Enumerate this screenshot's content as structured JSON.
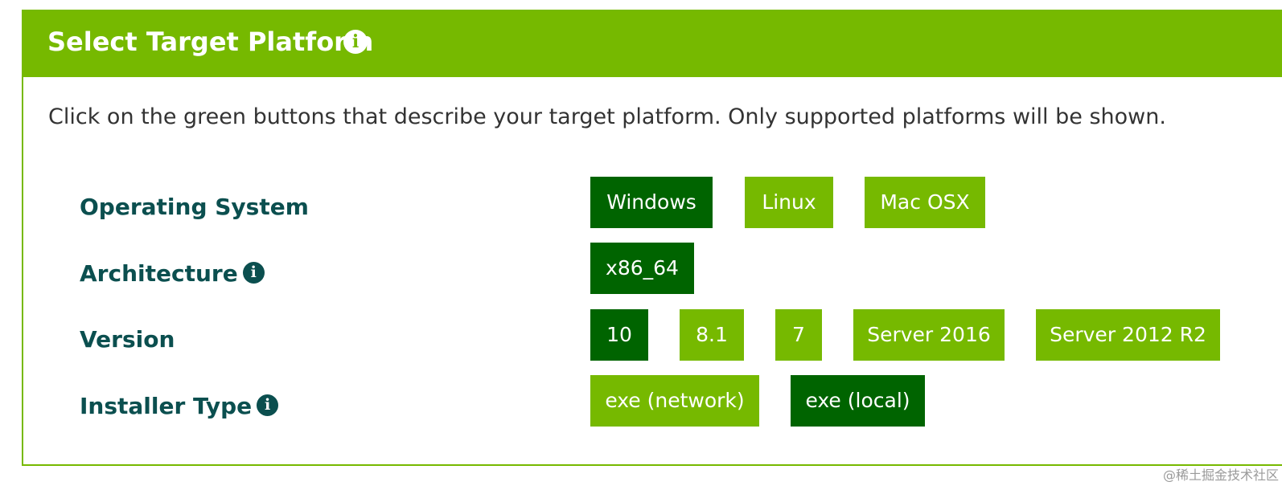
{
  "header": {
    "title": "Select Target Platform",
    "info_icon": "info-circle-icon"
  },
  "description": "Click on the green buttons that describe your target platform. Only supported platforms will be shown.",
  "colors": {
    "brand_green": "#76b900",
    "selected_green": "#006400",
    "label_teal": "#0b4f4f"
  },
  "rows": [
    {
      "label": "Operating System",
      "has_info": false,
      "options": [
        {
          "label": "Windows",
          "selected": true
        },
        {
          "label": "Linux",
          "selected": false
        },
        {
          "label": "Mac OSX",
          "selected": false
        }
      ]
    },
    {
      "label": "Architecture",
      "has_info": true,
      "options": [
        {
          "label": "x86_64",
          "selected": true
        }
      ]
    },
    {
      "label": "Version",
      "has_info": false,
      "options": [
        {
          "label": "10",
          "selected": true
        },
        {
          "label": "8.1",
          "selected": false
        },
        {
          "label": "7",
          "selected": false
        },
        {
          "label": "Server 2016",
          "selected": false
        },
        {
          "label": "Server 2012 R2",
          "selected": false
        }
      ]
    },
    {
      "label": "Installer Type",
      "has_info": true,
      "options": [
        {
          "label": "exe (network)",
          "selected": false
        },
        {
          "label": "exe (local)",
          "selected": true
        }
      ]
    }
  ],
  "watermark": "@稀土掘金技术社区"
}
